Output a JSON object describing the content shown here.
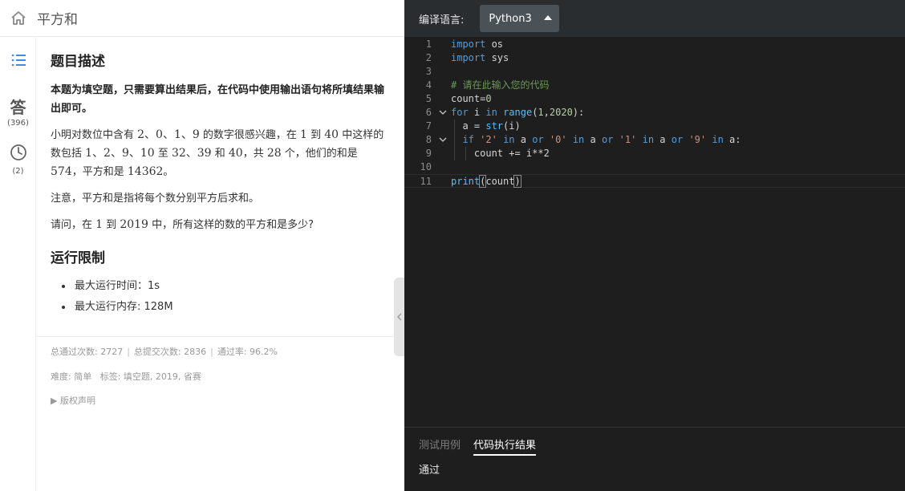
{
  "header": {
    "title": "平方和"
  },
  "sidebar": {
    "items": [
      {
        "icon": "list-icon",
        "count": ""
      },
      {
        "icon": "answer-icon",
        "glyph": "答",
        "count": "(396)"
      },
      {
        "icon": "clock-icon",
        "count": "(2)"
      }
    ]
  },
  "problem": {
    "heading": "题目描述",
    "note": "本题为填空题，只需要算出结果后，在代码中使用输出语句将所填结果输出即可。",
    "p1_pre": "小明对数位中含有 ",
    "p1_digits": "2、0、1、9",
    "p1_mid1": " 的数字很感兴趣，在 ",
    "p1_from": "1",
    "p1_mid2": " 到 ",
    "p1_to": "40",
    "p1_mid3": " 中这样的数包括 ",
    "p1_list": "1、2、9、10",
    "p1_mid4": " 至 ",
    "p1_list2": "32、39",
    "p1_mid5": " 和 ",
    "p1_last": "40",
    "p1_mid6": "，共 ",
    "p1_count": "28",
    "p1_mid7": " 个，他们的和是 ",
    "p1_sum": "574",
    "p1_mid8": "，平方和是 ",
    "p1_sq": "14362",
    "p1_end": "。",
    "p2": "注意，平方和是指将每个数分别平方后求和。",
    "p3_pre": "请问，在 ",
    "p3_from": "1",
    "p3_mid": " 到 ",
    "p3_to": "2019",
    "p3_end": " 中，所有这样的数的平方和是多少?"
  },
  "limits": {
    "heading": "运行限制",
    "items": [
      "最大运行时间：1s",
      "最大运行内存: 128M"
    ]
  },
  "stats": {
    "passed": "总通过次数: 2727",
    "submitted": "总提交次数: 2836",
    "rate": "通过率: 96.2%",
    "sep": "|"
  },
  "tags": {
    "difficulty": "难度: 简单",
    "labels": "标签: 填空题, 2019, 省赛"
  },
  "copyright": "▶ 版权声明",
  "editor": {
    "lang_label": "编译语言:",
    "lang_value": "Python3",
    "line_numbers": [
      "1",
      "2",
      "3",
      "4",
      "5",
      "6",
      "7",
      "8",
      "9",
      "10",
      "11"
    ]
  },
  "code": {
    "l1_kw": "import",
    "l1_rest": " os",
    "l2_kw": "import",
    "l2_rest": " sys",
    "l4": "# 请在此输入您的代码",
    "l5_a": "count=",
    "l5_n": "0",
    "l6_for": "for",
    "l6_i": " i ",
    "l6_in": "in",
    "l6_sp": " ",
    "l6_range": "range",
    "l6_open": "(",
    "l6_n1": "1",
    "l6_comma": ",",
    "l6_n2": "2020",
    "l6_close": "):",
    "l7_a": "a = ",
    "l7_str": "str",
    "l7_rest": "(i)",
    "l8_if": "if",
    "l8_s1": "'2'",
    "l8_in": "in",
    "l8_a": "a",
    "l8_or": "or",
    "l8_s2": "'0'",
    "l8_s3": "'1'",
    "l8_s4": "'9'",
    "l8_end": "a:",
    "l9": "count += i**2",
    "l11_print": "print",
    "l11_open": "(",
    "l11_arg": "count",
    "l11_close": ")"
  },
  "bottom": {
    "tab_test": "测试用例",
    "tab_result": "代码执行结果",
    "result": "通过"
  },
  "colors": {
    "editor_bg": "#1e1e1e",
    "keyword": "#569cd6",
    "string": "#ce9178",
    "number": "#b5cea8",
    "comment": "#6a9955"
  }
}
